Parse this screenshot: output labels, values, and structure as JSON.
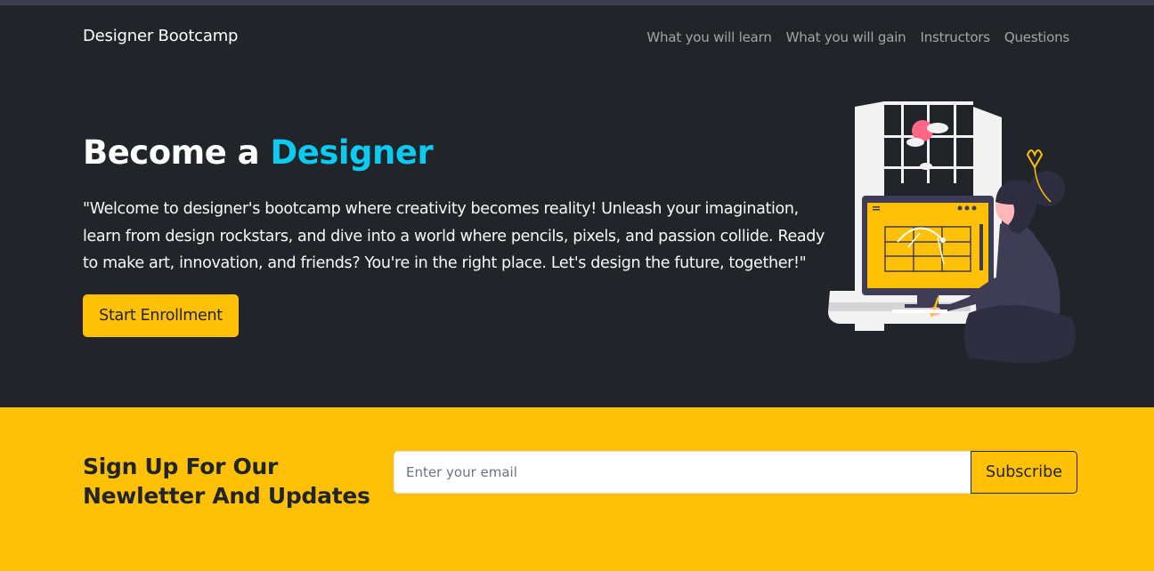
{
  "navbar": {
    "brand": "Designer Bootcamp",
    "links": [
      "What you will learn",
      "What you will gain",
      "Instructors",
      "Questions"
    ]
  },
  "hero": {
    "title_prefix": "Become a ",
    "title_accent": "Designer",
    "text": "\"Welcome to designer's bootcamp where creativity becomes reality! Unleash your imagination, learn from design rockstars, and dive into a world where pencils, pixels, and passion collide. Ready to make art, innovation, and friends? You're in the right place. Let's design the future, together!\"",
    "cta_label": "Start Enrollment",
    "illustration_icon": "designer-at-desk-illustration"
  },
  "newsletter": {
    "title": "Sign Up For Our Newletter And Updates",
    "placeholder": "Enter your email",
    "value": "",
    "button_label": "Subscribe"
  },
  "colors": {
    "dark": "#212529",
    "accent": "#0dcaf0",
    "warning": "#ffc107",
    "light": "#f8f9fa"
  }
}
